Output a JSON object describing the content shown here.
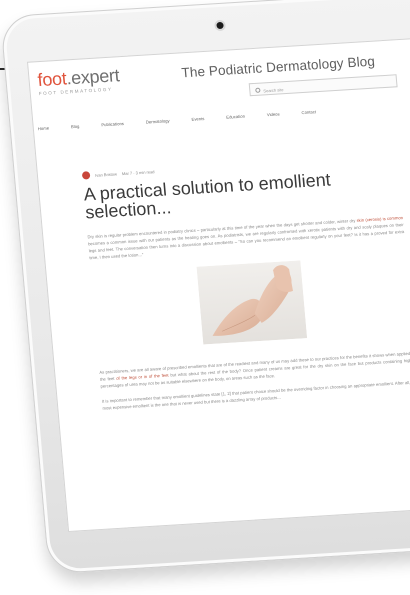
{
  "site": {
    "logo": {
      "brand_a": "foot",
      "brand_b": ".expert",
      "tagline": "FOOT DERMATOLOGY"
    },
    "blog_title": "The Podiatric Dermatology Blog",
    "search_placeholder": "Search site"
  },
  "nav": [
    "Home",
    "Blog",
    "Publications",
    "Dermatology",
    "Events",
    "Education",
    "Videos",
    "Contact"
  ],
  "post": {
    "author": "Ivan Bristow",
    "date": "Mar 7 · 3 min read",
    "title": "A practical solution to emollient selection...",
    "intro_a": "Dry skin is regular problem encountered in podiatry clinics – particularly at this time of the year when the days get shorter and colder, winter dry ",
    "intro_link": "skin (xerosis) is common",
    "intro_b": " becomes a common issue with our patients as the heating goes on. As podiatrists, we are regularly confronted with xerotic patients with dry and scaly plaques on their legs and feet. The conversation then turns into a discussion about emollients – \"So can you recommend an emollient regularly on your feet? Is it has a proved for extra time, I then used the lotion...\"",
    "outro_a": "As practitioners, we are all aware of prescribed emollients that are of the readiest and many of us may add these to our practices for the benefits it shows when applied to the feet ",
    "outro_link": "of the legs or in of the feet",
    "outro_b": " but what about the rest of the body? Once patient creams are great for the dry skin on the face but products containing higher percentages of urea may not be as suitable elsewhere on the body, on areas such as the face.",
    "outro2": "It is important to remember that many emollient guidelines state [1, 2] that patient choice should be the overriding factor in choosing an appropriate emollient. After all, the most expensive emollient is the one that is never used but there is a dazzling array of products..."
  },
  "colors": {
    "brand_accent": "#e0543d",
    "link": "#c0543f",
    "text": "#8a8a8a"
  }
}
